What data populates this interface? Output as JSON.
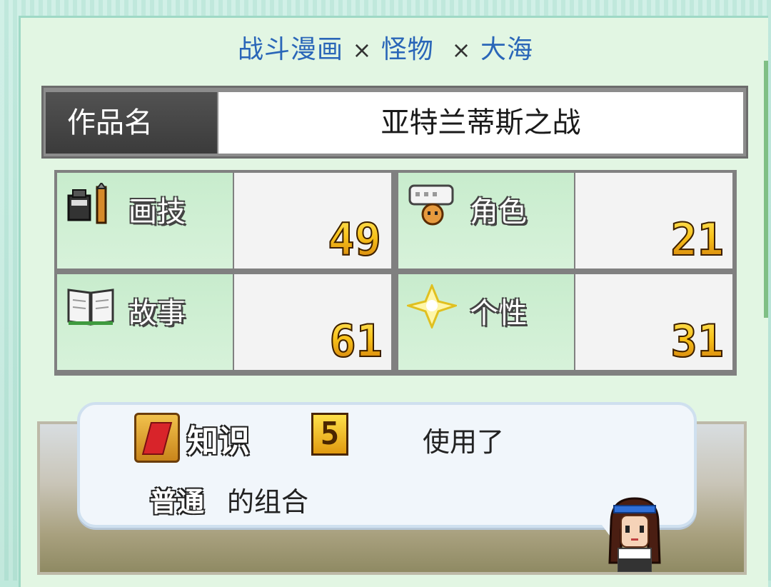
{
  "genre": {
    "part1": "战斗漫画",
    "sep1": "×",
    "part2": "怪物",
    "sep2": "×",
    "part3": "大海"
  },
  "title": {
    "label": "作品名",
    "value": "亚特兰蒂斯之战"
  },
  "stats": [
    {
      "name": "画技",
      "value": "49",
      "icon": "pen-ink-icon"
    },
    {
      "name": "角色",
      "value": "21",
      "icon": "character-speech-icon"
    },
    {
      "name": "故事",
      "value": "61",
      "icon": "open-book-icon"
    },
    {
      "name": "个性",
      "value": "31",
      "icon": "sparkle-icon"
    }
  ],
  "message": {
    "skill_name": "知识",
    "skill_level": "5",
    "used_text": "使用了",
    "rank_label": "普通",
    "combo_text": "的组合"
  },
  "colors": {
    "genre_text": "#2a66b8",
    "panel_bg": "#e2f6e3",
    "stat_label_bg": "#c8eccd",
    "number_gold": "#f8c21a"
  }
}
